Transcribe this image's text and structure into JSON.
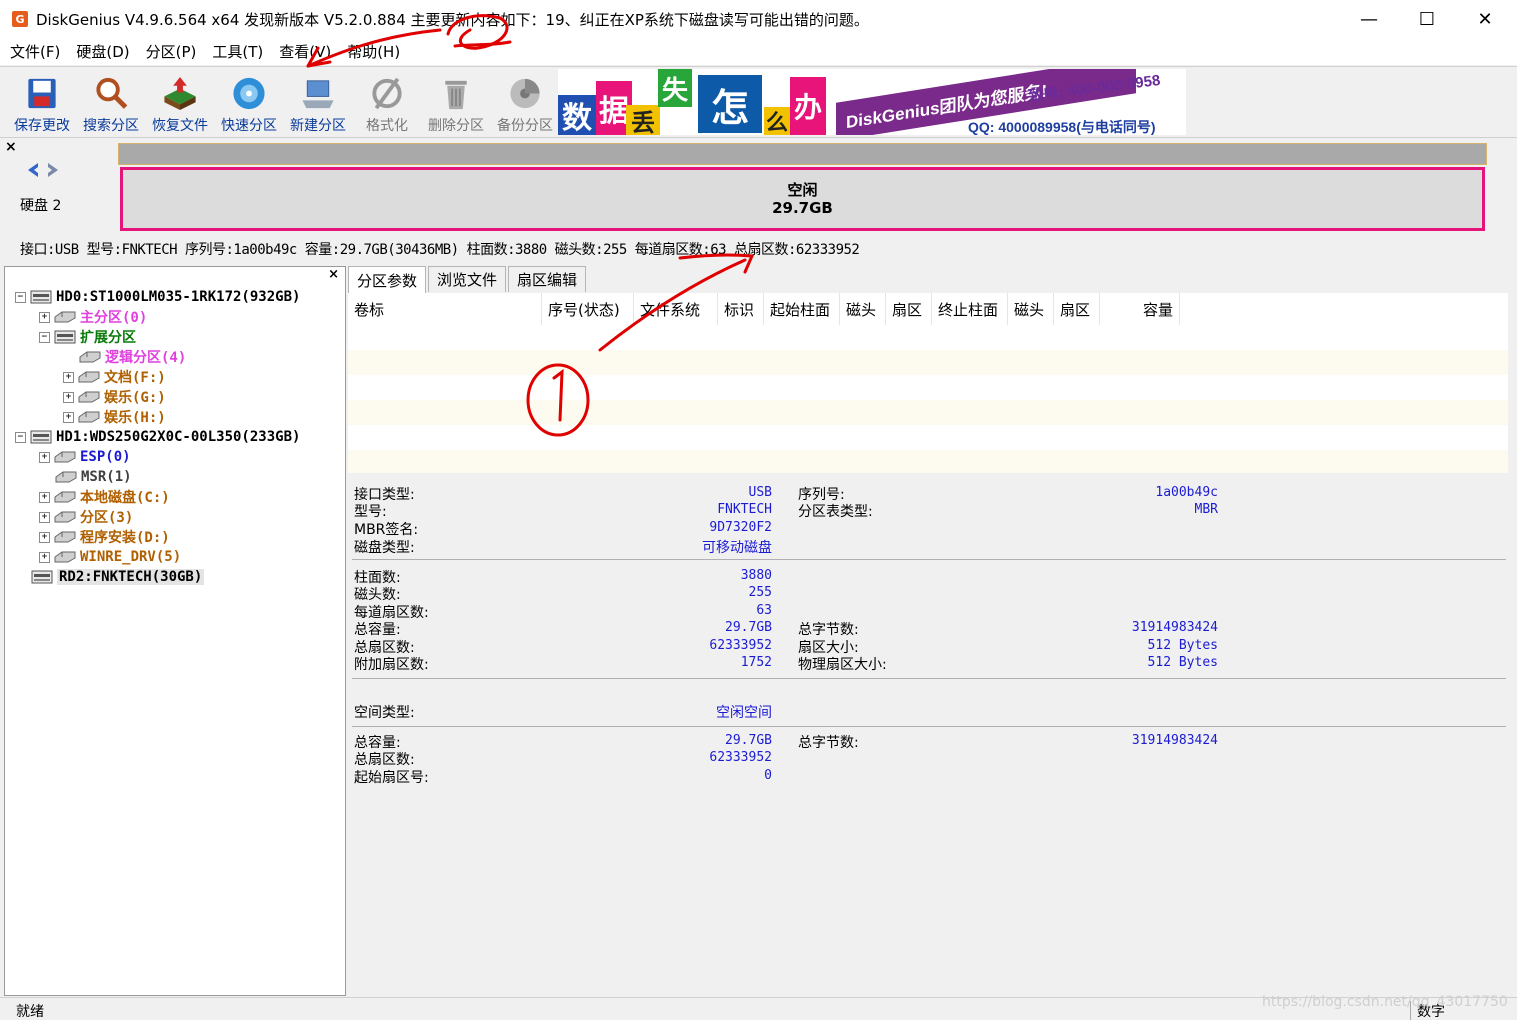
{
  "window": {
    "title": "DiskGenius V4.9.6.564 x64    发现新版本 V5.2.0.884 主要更新内容如下：19、纠正在XP系统下磁盘读写可能出错的问题。",
    "app_icon_glyph": "G",
    "minimize_glyph": "—",
    "maximize_glyph": "☐",
    "close_glyph": "✕"
  },
  "menu": [
    "文件(F)",
    "硬盘(D)",
    "分区(P)",
    "工具(T)",
    "查看(V)",
    "帮助(H)"
  ],
  "toolbar": {
    "buttons": [
      {
        "label": "保存更改",
        "icon": "save-icon",
        "enabled": true
      },
      {
        "label": "搜索分区",
        "icon": "search-icon",
        "enabled": true
      },
      {
        "label": "恢复文件",
        "icon": "recover-icon",
        "enabled": true
      },
      {
        "label": "快速分区",
        "icon": "quick-partition-icon",
        "enabled": true
      },
      {
        "label": "新建分区",
        "icon": "new-partition-icon",
        "enabled": true
      },
      {
        "label": "格式化",
        "icon": "format-icon",
        "enabled": false
      },
      {
        "label": "删除分区",
        "icon": "delete-icon",
        "enabled": false
      },
      {
        "label": "备份分区",
        "icon": "backup-icon",
        "enabled": false
      }
    ],
    "banner": {
      "tiles": [
        "数",
        "据",
        "丢",
        "失",
        "怎",
        "么",
        "办"
      ],
      "slogan": "DiskGenius团队为您服务!",
      "phone": "致电: 400-008-9958",
      "qq": "QQ: 4000089958(与电话同号)"
    }
  },
  "diskmap": {
    "close_glyph": "×",
    "disk_label": "硬盘 2",
    "free_label": "空闲",
    "free_size": "29.7GB",
    "info_line": "接口:USB  型号:FNKTECH  序列号:1a00b49c  容量:29.7GB(30436MB)  柱面数:3880  磁头数:255  每道扇区数:63  总扇区数:62333952"
  },
  "tree": {
    "close_glyph": "×",
    "nodes": [
      {
        "text": "HD0:ST1000LM035-1RK172(932GB)",
        "level": 0,
        "type": "disk",
        "expander": "−",
        "color": "#000000"
      },
      {
        "text": "主分区(0)",
        "level": 1,
        "type": "part",
        "expander": "+",
        "color": "#e040e0"
      },
      {
        "text": "扩展分区",
        "level": 1,
        "type": "ext",
        "expander": "−",
        "color": "#0a7a0a"
      },
      {
        "text": "逻辑分区(4)",
        "level": 2,
        "type": "part",
        "expander": "",
        "color": "#e040e0"
      },
      {
        "text": "文档(F:)",
        "level": 2,
        "type": "part",
        "expander": "+",
        "color": "#b06000"
      },
      {
        "text": "娱乐(G:)",
        "level": 2,
        "type": "part",
        "expander": "+",
        "color": "#b06000"
      },
      {
        "text": "娱乐(H:)",
        "level": 2,
        "type": "part",
        "expander": "+",
        "color": "#b06000"
      },
      {
        "text": "HD1:WDS250G2X0C-00L350(233GB)",
        "level": 0,
        "type": "disk",
        "expander": "−",
        "color": "#000000"
      },
      {
        "text": "ESP(0)",
        "level": 1,
        "type": "part",
        "expander": "+",
        "color": "#1b1bd4"
      },
      {
        "text": "MSR(1)",
        "level": 1,
        "type": "part",
        "expander": "",
        "color": "#404040"
      },
      {
        "text": "本地磁盘(C:)",
        "level": 1,
        "type": "part",
        "expander": "+",
        "color": "#b06000"
      },
      {
        "text": "分区(3)",
        "level": 1,
        "type": "part",
        "expander": "+",
        "color": "#b06000"
      },
      {
        "text": "程序安装(D:)",
        "level": 1,
        "type": "part",
        "expander": "+",
        "color": "#b06000"
      },
      {
        "text": "WINRE_DRV(5)",
        "level": 1,
        "type": "part",
        "expander": "+",
        "color": "#b06000"
      },
      {
        "text": "RD2:FNKTECH(30GB)",
        "level": 0,
        "type": "disk",
        "expander": "",
        "color": "#000000",
        "selected": true
      }
    ]
  },
  "tabs": [
    "分区参数",
    "浏览文件",
    "扇区编辑"
  ],
  "partition_table": {
    "columns": [
      "卷标",
      "序号(状态)",
      "文件系统",
      "标识",
      "起始柱面",
      "磁头",
      "扇区",
      "终止柱面",
      "磁头",
      "扇区",
      "容量"
    ]
  },
  "details": {
    "interface_type_label": "接口类型:",
    "interface_type": "USB",
    "model_label": "型号:",
    "model": "FNKTECH",
    "mbr_sig_label": "MBR签名:",
    "mbr_sig": "9D7320F2",
    "disk_type_label": "磁盘类型:",
    "disk_type": "可移动磁盘",
    "serial_label": "序列号:",
    "serial": "1a00b49c",
    "pt_type_label": "分区表类型:",
    "pt_type": "MBR",
    "cylinders_label": "柱面数:",
    "cylinders": "3880",
    "heads_label": "磁头数:",
    "heads": "255",
    "spt_label": "每道扇区数:",
    "spt": "63",
    "total_cap_label": "总容量:",
    "total_cap": "29.7GB",
    "total_sectors_label": "总扇区数:",
    "total_sectors": "62333952",
    "extra_sectors_label": "附加扇区数:",
    "extra_sectors": "1752",
    "total_bytes_label": "总字节数:",
    "total_bytes": "31914983424",
    "sector_size_label": "扇区大小:",
    "sector_size": "512 Bytes",
    "phys_sector_label": "物理扇区大小:",
    "phys_sector": "512 Bytes",
    "space_type_label": "空间类型:",
    "space_type": "空闲空间",
    "free_cap_label": "总容量:",
    "free_cap": "29.7GB",
    "free_sectors_label": "总扇区数:",
    "free_sectors": "62333952",
    "start_sector_label": "起始扇区号:",
    "start_sector": "0",
    "free_bytes_label": "总字节数:",
    "free_bytes": "31914983424"
  },
  "status": {
    "text": "就绪",
    "num": "数字",
    "watermark": "https://blog.csdn.net/qq_43017750"
  },
  "colors": {
    "link_blue": "#1b1bd4",
    "free_border": "#e4147a",
    "annotation_red": "#e00000"
  }
}
